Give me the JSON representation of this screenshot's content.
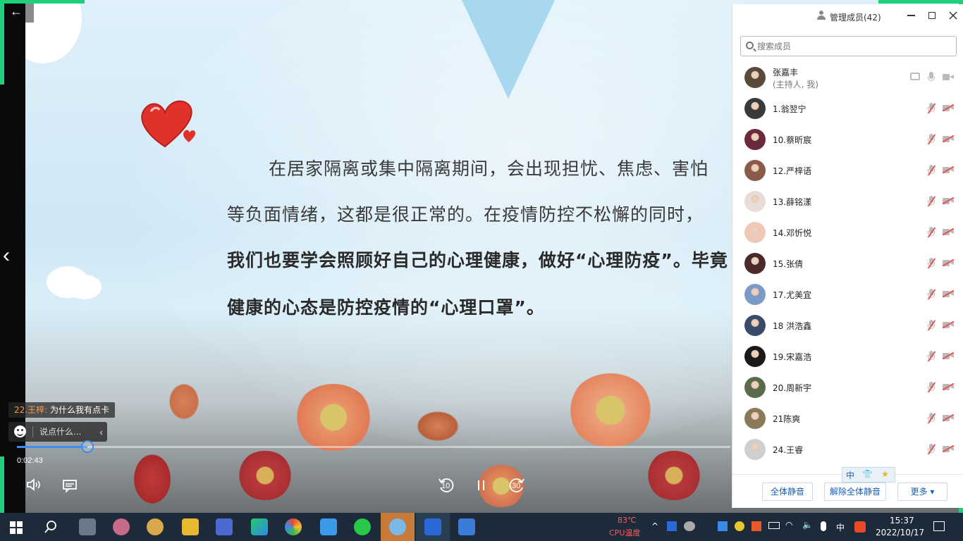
{
  "slide": {
    "lines": [
      "在居家隔离或集中隔离期间，会出现担忧、焦虑、害怕",
      "等负面情绪，这都是很正常的。在疫情防控不松懈的同时，",
      "我们也要学会照顾好自己的心理健康，做好“心理防疫”。毕竟",
      "健康的心态是防控疫情的“心理口罩”。"
    ]
  },
  "player": {
    "back_icon": "back-arrow-icon",
    "prev_icon": "chevron-left-icon",
    "chat_message": {
      "sender": "22.王梓:",
      "text": "为什么我有点卡"
    },
    "chat_placeholder": "说点什么...",
    "collapse_symbol": "‹",
    "current_time": "0:02:43",
    "progress_fraction": 0.099,
    "controls": {
      "rewind_label": "10",
      "forward_label": "30"
    }
  },
  "panel": {
    "title": "管理成员(42)",
    "search_placeholder": "搜索成员",
    "members": [
      {
        "name": "张嘉丰",
        "sub": "(主持人, 我)",
        "host": true,
        "avatar_color": "#5a4a3a"
      },
      {
        "name": "1.翁翌宁",
        "sub": "",
        "avatar_color": "#3a3a3a"
      },
      {
        "name": "10.蔡昕宸",
        "sub": "",
        "avatar_color": "#6a2a3a"
      },
      {
        "name": "12.严梓语",
        "sub": "",
        "avatar_color": "#8a5a4a"
      },
      {
        "name": "13.薛铭漾",
        "sub": "",
        "avatar_color": "#e8dcd8"
      },
      {
        "name": "14.邓忻悦",
        "sub": "",
        "avatar_color": "#f0c8b8"
      },
      {
        "name": "15.张倩",
        "sub": "",
        "avatar_color": "#4a2a2a"
      },
      {
        "name": "17.尤美宜",
        "sub": "",
        "avatar_color": "#7a9ac8"
      },
      {
        "name": "18  洪浩鑫",
        "sub": "",
        "avatar_color": "#3a4a6a"
      },
      {
        "name": "19.宋嘉浩",
        "sub": "",
        "avatar_color": "#1a1a1a"
      },
      {
        "name": "20.周新宇",
        "sub": "",
        "avatar_color": "#5a6a4a"
      },
      {
        "name": "21陈爽",
        "sub": "",
        "avatar_color": "#8a7a5a"
      },
      {
        "name": "24.王睿",
        "sub": "",
        "avatar_color": "#cfcfcf"
      }
    ],
    "footer": {
      "mute_all": "全体静音",
      "unmute_all": "解除全体静音",
      "more": "更多 ▾"
    }
  },
  "ime": {
    "lang": "中",
    "shirt": "👕",
    "star": "★"
  },
  "taskbar": {
    "temp": "83℃",
    "temp_label": "CPU温度",
    "input_lang": "中",
    "time": "15:37",
    "date": "2022/10/17"
  },
  "colors": {
    "accent_green": "#1ed07a",
    "progress_blue": "#3c8cf0",
    "link_blue": "#1a5fb4",
    "mute_red": "#e25555"
  }
}
